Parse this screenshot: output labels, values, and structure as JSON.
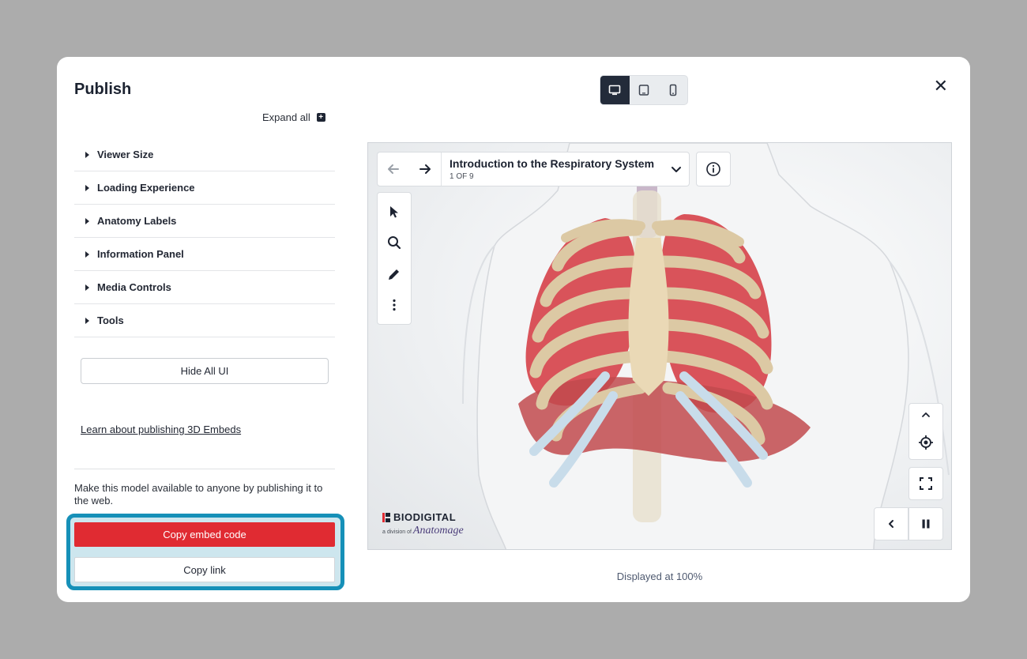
{
  "modal": {
    "title": "Publish",
    "expand_all_label": "Expand all",
    "close_symbol": "✕"
  },
  "device_toggle": {
    "options": [
      {
        "name": "desktop-icon",
        "active": true
      },
      {
        "name": "tablet-icon",
        "active": false
      },
      {
        "name": "mobile-icon",
        "active": false
      }
    ]
  },
  "accordion": {
    "items": [
      {
        "label": "Viewer Size"
      },
      {
        "label": "Loading Experience"
      },
      {
        "label": "Anatomy Labels"
      },
      {
        "label": "Information Panel"
      },
      {
        "label": "Media Controls"
      },
      {
        "label": "Tools"
      }
    ]
  },
  "hide_ui_label": "Hide All UI",
  "learn_link": "Learn about publishing 3D Embeds",
  "publish_description": "Make this model available to anyone by publishing it to the web.",
  "buttons": {
    "copy_embed": "Copy embed code",
    "copy_link": "Copy link"
  },
  "viewer": {
    "tour_title": "Introduction to the Respiratory System",
    "tour_count": "1 OF 9",
    "logo_name": "BIODIGITAL",
    "logo_division_prefix": "a division of",
    "logo_division_brand": "Anatomage"
  },
  "displayed_at": "Displayed at 100%",
  "colors": {
    "accent_red": "#e02b32",
    "highlight_border": "#1690b8",
    "dark_toggle": "#232b3a"
  }
}
